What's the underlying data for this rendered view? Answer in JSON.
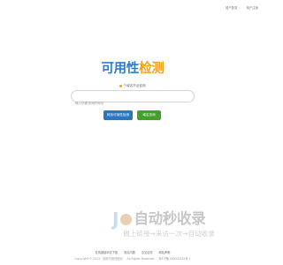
{
  "header": {
    "links": [
      "用户登录",
      "用户注册"
    ]
  },
  "logo": {
    "part1": "可用性",
    "part2": "检测"
  },
  "hint": {
    "text": "个域名节点检测"
  },
  "search": {
    "placeholder": "输入您要查询的网址"
  },
  "buttons": {
    "primary": "网页可用性检测",
    "secondary": "域名查询"
  },
  "watermark": {
    "mark": "J",
    "brand": "自动秒收录",
    "tagline": "做上链接→来访一次→自动收录"
  },
  "footer": {
    "links": [
      "友情链接申请下载",
      "常见问题",
      "意见反馈",
      "网站声明"
    ],
    "copyright": "Copyright © 2023 · 网页可用性检测",
    "rights": "All Rights Reserved",
    "icp": "粤ICP备 XXXXXXXX号-1"
  },
  "colors": {
    "brand_blue": "#2a7fd0",
    "brand_orange": "#f3a01e",
    "button_blue": "#2a76bf",
    "button_green": "#43a02b"
  }
}
